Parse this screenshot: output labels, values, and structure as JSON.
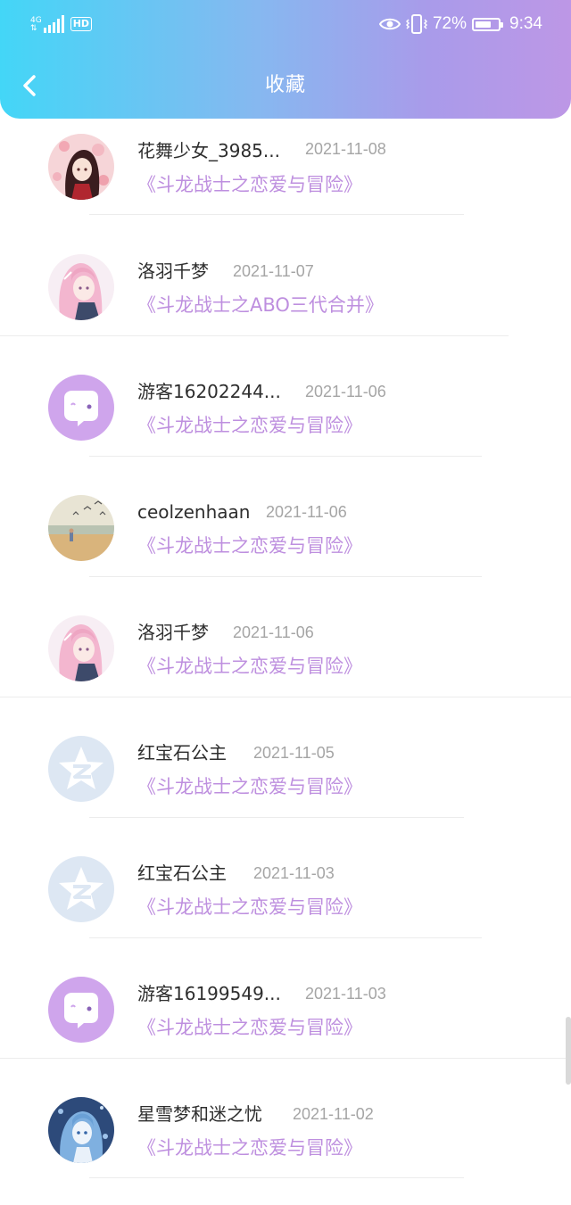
{
  "status_bar": {
    "network_label": "4G",
    "hd_label": "HD",
    "battery_percent": "72%",
    "battery_level": 0.72,
    "time": "9:34",
    "icons": [
      "signal-icon",
      "eye-icon",
      "vibrate-icon",
      "battery-icon"
    ]
  },
  "header": {
    "title": "收藏",
    "back_icon": "back-arrow-icon"
  },
  "colors": {
    "header_gradient_start": "#43d6f7",
    "header_gradient_end": "#bd97e6",
    "book_title": "#be8fdf",
    "date_text": "#a5a5a5",
    "username_text": "#2e2e2e"
  },
  "favorites": [
    {
      "username": "花舞少女_3985...",
      "date": "2021-11-08",
      "book": "《斗龙战士之恋爱与冒险》",
      "avatar": "anime-girl-red-avatar"
    },
    {
      "username": "洛羽千梦",
      "date": "2021-11-07",
      "book": "《斗龙战士之ABO三代合并》",
      "avatar": "anime-girl-pink-avatar"
    },
    {
      "username": "游客16202244...",
      "date": "2021-11-06",
      "book": "《斗龙战士之恋爱与冒险》",
      "avatar": "guest-chat-avatar"
    },
    {
      "username": "ceolzenhaan",
      "date": "2021-11-06",
      "book": "《斗龙战士之恋爱与冒险》",
      "avatar": "beach-seagulls-avatar"
    },
    {
      "username": "洛羽千梦",
      "date": "2021-11-06",
      "book": "《斗龙战士之恋爱与冒险》",
      "avatar": "anime-girl-pink-avatar"
    },
    {
      "username": "红宝石公主",
      "date": "2021-11-05",
      "book": "《斗龙战士之恋爱与冒险》",
      "avatar": "qzone-star-avatar"
    },
    {
      "username": "红宝石公主",
      "date": "2021-11-03",
      "book": "《斗龙战士之恋爱与冒险》",
      "avatar": "qzone-star-avatar"
    },
    {
      "username": "游客16199549...",
      "date": "2021-11-03",
      "book": "《斗龙战士之恋爱与冒险》",
      "avatar": "guest-chat-avatar"
    },
    {
      "username": "星雪梦和迷之忧",
      "date": "2021-11-02",
      "book": "《斗龙战士之恋爱与冒险》",
      "avatar": "anime-girl-blue-avatar"
    }
  ]
}
